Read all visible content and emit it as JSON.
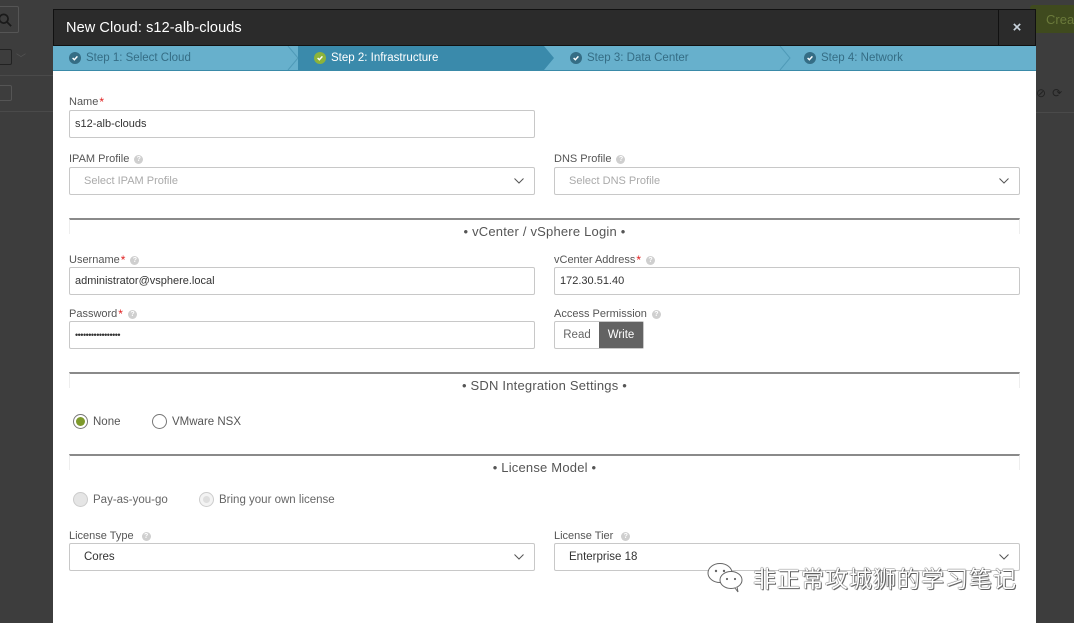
{
  "background": {
    "create_button_label": "Create"
  },
  "modal": {
    "title": "New Cloud: s12-alb-clouds",
    "close_label": "×",
    "steps": [
      {
        "label": "Step 1: Select Cloud",
        "state": "done"
      },
      {
        "label": "Step 2: Infrastructure",
        "state": "active"
      },
      {
        "label": "Step 3: Data Center",
        "state": "pending"
      },
      {
        "label": "Step 4: Network",
        "state": "pending"
      }
    ]
  },
  "form": {
    "name": {
      "label": "Name",
      "required": "*",
      "value": "s12-alb-clouds"
    },
    "ipam_profile": {
      "label": "IPAM Profile",
      "placeholder": "Select IPAM Profile"
    },
    "dns_profile": {
      "label": "DNS Profile",
      "placeholder": "Select DNS Profile"
    },
    "vcenter_section": {
      "title": "• vCenter / vSphere Login •"
    },
    "username": {
      "label": "Username",
      "required": "*",
      "value": "administrator@vsphere.local"
    },
    "vcenter_address": {
      "label": "vCenter Address",
      "required": "*",
      "value": "172.30.51.40"
    },
    "password": {
      "label": "Password",
      "required": "*",
      "value": "•••••••••••••••••"
    },
    "access_permission": {
      "label": "Access Permission",
      "options": [
        "Read",
        "Write"
      ],
      "selected": "Write"
    },
    "sdn_section": {
      "title": "• SDN Integration Settings •"
    },
    "sdn_options": [
      {
        "label": "None",
        "selected": true
      },
      {
        "label": "VMware NSX",
        "selected": false
      }
    ],
    "license_section": {
      "title": "• License Model •"
    },
    "license_model_options": [
      {
        "label": "Pay-as-you-go",
        "selected": false,
        "disabled": true
      },
      {
        "label": "Bring your own license",
        "selected": true,
        "disabled": true
      }
    ],
    "license_type": {
      "label": "License Type",
      "value": "Cores"
    },
    "license_tier": {
      "label": "License Tier",
      "value": "Enterprise 18"
    }
  },
  "watermark": {
    "text": "非正常攻城狮的学习笔记"
  },
  "colors": {
    "step_bar": "#67b0cc",
    "step_active": "#3a8aab",
    "check_active": "#8db33a",
    "radio_selected": "#7e9a2c",
    "toggle_selected": "#636363",
    "required": "#e02020"
  }
}
